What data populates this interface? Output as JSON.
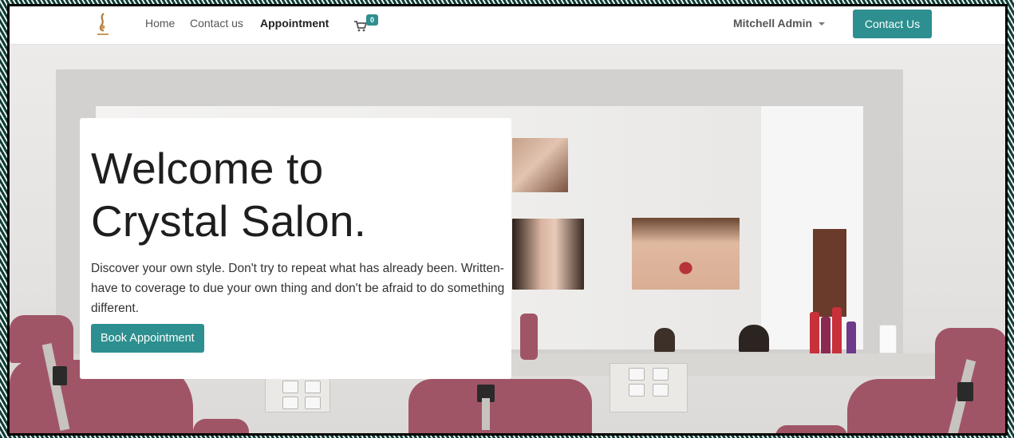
{
  "navbar": {
    "links": [
      {
        "label": "Home"
      },
      {
        "label": "Contact us"
      },
      {
        "label": "Appointment",
        "active": true
      }
    ],
    "cart_count": "0",
    "user_name": "Mitchell Admin",
    "contact_button": "Contact Us"
  },
  "hero": {
    "headline_line1": "Welcome to",
    "headline_line2": "Crystal Salon.",
    "description": "Discover your own style. Don't try to repeat what has already been. Written-have to coverage to due your own thing and don't be afraid to do something different.",
    "cta_button": "Book Appointment"
  },
  "colors": {
    "accent": "#2d8f8f",
    "chair": "#a05566"
  },
  "icons": [
    "logo",
    "cart-icon",
    "caret-down-icon"
  ]
}
